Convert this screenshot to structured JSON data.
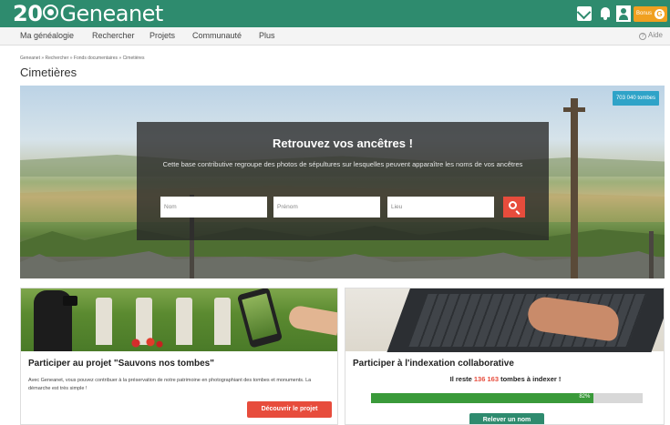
{
  "header": {
    "logo_number": "20",
    "logo_text": "Geneanet",
    "premium_label": "Bonus",
    "premium_coin": "G"
  },
  "nav": {
    "items": [
      "Ma généalogie",
      "Rechercher",
      "Projets",
      "Communauté",
      "Plus"
    ],
    "help_label": "Aide"
  },
  "breadcrumb": "Geneanet » Rechercher » Fonds documentaires » Cimetières",
  "page_title": "Cimetières",
  "hero": {
    "badge": "703 040 tombes",
    "title": "Retrouvez vos ancêtres !",
    "description": "Cette base contributive regroupe des photos de sépultures sur lesquelles peuvent apparaître les noms de vos ancêtres",
    "search": {
      "nom_placeholder": "Nom",
      "prenom_placeholder": "Prénom",
      "lieu_placeholder": "Lieu"
    }
  },
  "card_left": {
    "title": "Participer au projet \"Sauvons nos tombes\"",
    "text": "Avec Geneanet, vous pouvez contribuer à la préservation de notre patrimoine en photographiant des tombes et monuments. La démarche est très simple !",
    "button": "Découvrir le projet"
  },
  "card_right": {
    "title": "Participer à l'indexation collaborative",
    "remaining_prefix": "Il reste ",
    "remaining_number": "136 163",
    "remaining_suffix": " tombes à indexer !",
    "progress_percent": 82,
    "progress_label": "82%",
    "button": "Relever un nom"
  },
  "colors": {
    "brand_green": "#2e8b6e",
    "accent_red": "#e74c3c",
    "premium_orange": "#f0a020",
    "badge_blue": "#2fa3c8"
  }
}
